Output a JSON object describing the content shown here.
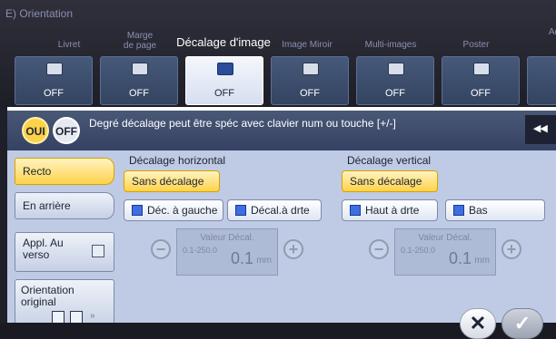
{
  "breadcrumb": "E) Orientation",
  "tabs": [
    {
      "label": "Livret",
      "value": "OFF"
    },
    {
      "label": "Marge\nde page",
      "value": "OFF"
    },
    {
      "label": "Décalage d'image",
      "value": "OFF"
    },
    {
      "label": "Image Miroir",
      "value": "OFF"
    },
    {
      "label": "Multi-images",
      "value": "OFF"
    },
    {
      "label": "Poster",
      "value": "OFF"
    },
    {
      "label": "Ad",
      "value": ""
    }
  ],
  "panel": {
    "toggle_on": "OUI",
    "toggle_off": "OFF",
    "hint": "Degré décalage peut être spéc avec clavier num ou touche [+/-]",
    "expand": "◂◂"
  },
  "side": {
    "recto": "Recto",
    "arriere": "En arrière",
    "appl": "Appl. Au verso",
    "orientation": "Orientation original"
  },
  "horizontal": {
    "title": "Décalage horizontal",
    "none": "Sans décalage",
    "left": "Déc. à gauche",
    "right": "Décal.à drte",
    "val_label": "Valeur Décal.",
    "range": "0.1-250.0",
    "value": "0.1",
    "unit": "mm"
  },
  "vertical": {
    "title": "Décalage vertical",
    "none": "Sans décalage",
    "top": "Haut à drte",
    "bottom": "Bas",
    "val_label": "Valeur Décal.",
    "range": "0.1-250.0",
    "value": "0.1",
    "unit": "mm"
  },
  "footer": {
    "cancel": "✕",
    "ok": "✓"
  },
  "colors": {
    "accent": "#ffd24b",
    "panel": "#bfcbe4"
  }
}
